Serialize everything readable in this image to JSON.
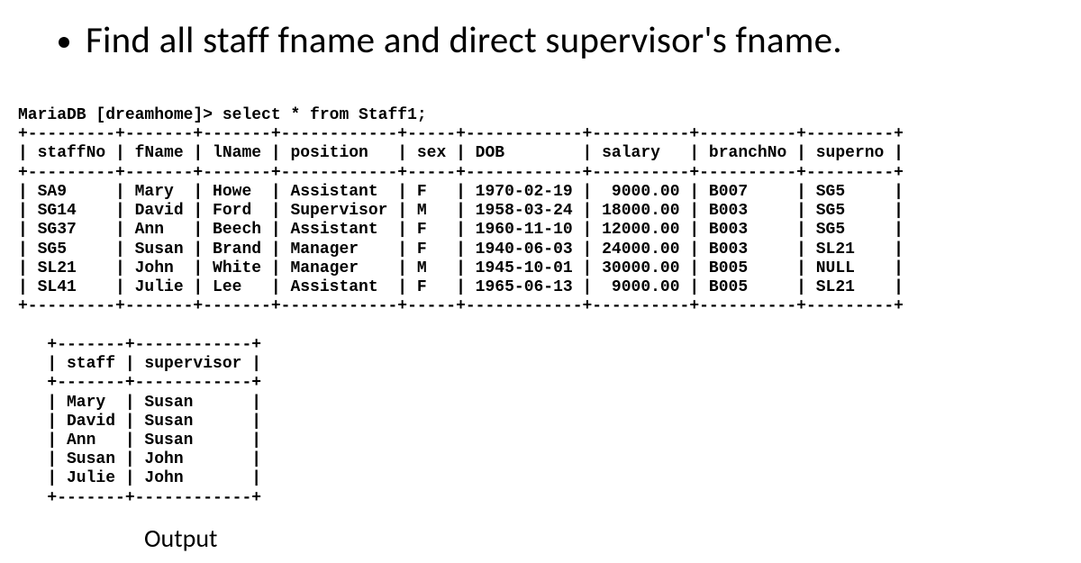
{
  "bullet": {
    "text": "Find all staff fname and direct supervisor's fname."
  },
  "prompt_line": "MariaDB [dreamhome]> select * from Staff1;",
  "staff_table": {
    "columns": [
      "staffNo",
      "fName",
      "lName",
      "position",
      "sex",
      "DOB",
      "salary",
      "branchNo",
      "superno"
    ],
    "rows": [
      {
        "staffNo": "SA9",
        "fName": "Mary",
        "lName": "Howe",
        "position": "Assistant",
        "sex": "F",
        "DOB": "1970-02-19",
        "salary": "9000.00",
        "branchNo": "B007",
        "superno": "SG5"
      },
      {
        "staffNo": "SG14",
        "fName": "David",
        "lName": "Ford",
        "position": "Supervisor",
        "sex": "M",
        "DOB": "1958-03-24",
        "salary": "18000.00",
        "branchNo": "B003",
        "superno": "SG5"
      },
      {
        "staffNo": "SG37",
        "fName": "Ann",
        "lName": "Beech",
        "position": "Assistant",
        "sex": "F",
        "DOB": "1960-11-10",
        "salary": "12000.00",
        "branchNo": "B003",
        "superno": "SG5"
      },
      {
        "staffNo": "SG5",
        "fName": "Susan",
        "lName": "Brand",
        "position": "Manager",
        "sex": "F",
        "DOB": "1940-06-03",
        "salary": "24000.00",
        "branchNo": "B003",
        "superno": "SL21"
      },
      {
        "staffNo": "SL21",
        "fName": "John",
        "lName": "White",
        "position": "Manager",
        "sex": "M",
        "DOB": "1945-10-01",
        "salary": "30000.00",
        "branchNo": "B005",
        "superno": "NULL"
      },
      {
        "staffNo": "SL41",
        "fName": "Julie",
        "lName": "Lee",
        "position": "Assistant",
        "sex": "F",
        "DOB": "1965-06-13",
        "salary": "9000.00",
        "branchNo": "B005",
        "superno": "SL21"
      }
    ]
  },
  "result_table": {
    "columns": [
      "staff",
      "supervisor"
    ],
    "rows": [
      {
        "staff": "Mary",
        "supervisor": "Susan"
      },
      {
        "staff": "David",
        "supervisor": "Susan"
      },
      {
        "staff": "Ann",
        "supervisor": "Susan"
      },
      {
        "staff": "Susan",
        "supervisor": "John"
      },
      {
        "staff": "Julie",
        "supervisor": "John"
      }
    ]
  },
  "output_label": "Output",
  "chart_data": {
    "type": "table",
    "tables": [
      {
        "title": "Staff1",
        "columns": [
          "staffNo",
          "fName",
          "lName",
          "position",
          "sex",
          "DOB",
          "salary",
          "branchNo",
          "superno"
        ],
        "rows": [
          [
            "SA9",
            "Mary",
            "Howe",
            "Assistant",
            "F",
            "1970-02-19",
            9000.0,
            "B007",
            "SG5"
          ],
          [
            "SG14",
            "David",
            "Ford",
            "Supervisor",
            "M",
            "1958-03-24",
            18000.0,
            "B003",
            "SG5"
          ],
          [
            "SG37",
            "Ann",
            "Beech",
            "Assistant",
            "F",
            "1960-11-10",
            12000.0,
            "B003",
            "SG5"
          ],
          [
            "SG5",
            "Susan",
            "Brand",
            "Manager",
            "F",
            "1940-06-03",
            24000.0,
            "B003",
            "SL21"
          ],
          [
            "SL21",
            "John",
            "White",
            "Manager",
            "M",
            "1945-10-01",
            30000.0,
            "B005",
            null
          ],
          [
            "SL41",
            "Julie",
            "Lee",
            "Assistant",
            "F",
            "1965-06-13",
            9000.0,
            "B005",
            "SL21"
          ]
        ]
      },
      {
        "title": "Output",
        "columns": [
          "staff",
          "supervisor"
        ],
        "rows": [
          [
            "Mary",
            "Susan"
          ],
          [
            "David",
            "Susan"
          ],
          [
            "Ann",
            "Susan"
          ],
          [
            "Susan",
            "John"
          ],
          [
            "Julie",
            "John"
          ]
        ]
      }
    ]
  }
}
